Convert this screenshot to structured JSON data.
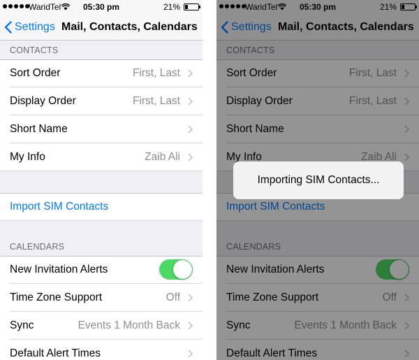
{
  "status_bar": {
    "carrier": "WaridTel",
    "time": "05:30 pm",
    "battery_percent": "21%",
    "battery_level": 0.21
  },
  "nav": {
    "back_label": "Settings",
    "title": "Mail, Contacts, Calendars"
  },
  "contacts_section": {
    "header": "CONTACTS",
    "rows": [
      {
        "label": "Sort Order",
        "value": "First, Last"
      },
      {
        "label": "Display Order",
        "value": "First, Last"
      },
      {
        "label": "Short Name",
        "value": ""
      },
      {
        "label": "My Info",
        "value": "Zaib Ali"
      }
    ]
  },
  "import_row": {
    "label": "Import SIM Contacts"
  },
  "calendars_section": {
    "header": "CALENDARS",
    "rows": [
      {
        "label": "New Invitation Alerts",
        "toggle_on": true
      },
      {
        "label": "Time Zone Support",
        "value": "Off"
      },
      {
        "label": "Sync",
        "value": "Events 1 Month Back"
      },
      {
        "label": "Default Alert Times",
        "value": ""
      }
    ]
  },
  "hud": {
    "message": "Importing SIM Contacts..."
  },
  "colors": {
    "accent": "#007aff",
    "toggle_on": "#4cd964",
    "value_gray": "#8e8e93",
    "header_gray": "#6d6d72"
  }
}
